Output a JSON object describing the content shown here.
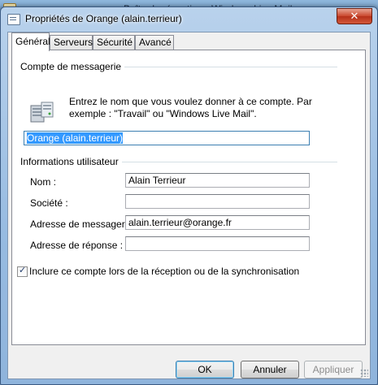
{
  "background_window": {
    "title": "Boîte de réception - Windows Live Mail"
  },
  "dialog": {
    "title": "Propriétés de Orange (alain.terrieur)",
    "close_glyph": "✕"
  },
  "tabs": [
    {
      "label": "Général",
      "active": true
    },
    {
      "label": "Serveurs",
      "active": false
    },
    {
      "label": "Sécurité",
      "active": false
    },
    {
      "label": "Avancé",
      "active": false
    }
  ],
  "account": {
    "group_label": "Compte de messagerie",
    "explanation": "Entrez le nom que vous voulez donner à ce compte. Par exemple : \"Travail\" ou \"Windows Live Mail\".",
    "name_value": "Orange (alain.terrieur)"
  },
  "user_info": {
    "group_label": "Informations utilisateur",
    "name_label": "Nom :",
    "name_value": "Alain Terrieur",
    "company_label": "Société :",
    "company_value": "",
    "email_label": "Adresse de messagerie :",
    "email_value": "alain.terrieur@orange.fr",
    "reply_label": "Adresse de réponse :",
    "reply_value": ""
  },
  "include_checkbox": {
    "label": "Inclure ce compte lors de la réception ou de la synchronisation",
    "checked": true
  },
  "buttons": {
    "ok": "OK",
    "cancel": "Annuler",
    "apply": "Appliquer"
  }
}
